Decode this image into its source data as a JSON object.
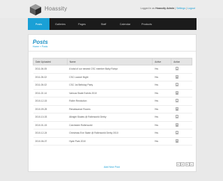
{
  "header": {
    "logo_text": "Hoassity",
    "logged_in_prefix": "Logged in as",
    "user_name": "Hoassity Admin",
    "separator1": "|",
    "settings_label": "Settings",
    "separator2": "|",
    "logout_label": "Logout"
  },
  "nav": {
    "items": [
      {
        "label": "Posts"
      },
      {
        "label": "Galleries"
      },
      {
        "label": "Pages"
      },
      {
        "label": "Staff"
      },
      {
        "label": "Calendar"
      },
      {
        "label": "Products"
      }
    ]
  },
  "main": {
    "title": "Posts",
    "breadcrumb": "Home » Posts",
    "columns": [
      "Date Uploaded",
      "Name",
      "Active",
      "Action"
    ],
    "rows": [
      {
        "date": "2011-06-05",
        "name": "A total of our newest CSC member Baby Robyn",
        "active": "Yes"
      },
      {
        "date": "2011-05-02",
        "name": "CSC Launch Night",
        "active": "Yes"
      },
      {
        "date": "2011-05-02",
        "name": "CSC 1st Birthday Party",
        "active": "Yes"
      },
      {
        "date": "2011-02-14",
        "name": "Various Skate Events 2010",
        "active": "Yes"
      },
      {
        "date": "2010-12-15",
        "name": "Roller Revolution",
        "active": "Yes"
      },
      {
        "date": "2010-09-25",
        "name": "Renaissance Rooms",
        "active": "Yes"
      },
      {
        "date": "2010-10-03",
        "name": "Allnight Skates @ Rollerworld Derby",
        "active": "Yes"
      },
      {
        "date": "2010-01-15",
        "name": "Colchester Rollerworld",
        "active": "Yes"
      },
      {
        "date": "2010-12-24",
        "name": "Christmas Eve Skate @ Rollerworld Derby 2010",
        "active": "Yes"
      },
      {
        "date": "2010-06-07",
        "name": "Hyde Park 2010",
        "active": "Yes"
      }
    ],
    "add_link": "Add New Post",
    "pagination": [
      "1",
      "2",
      "3",
      "»"
    ]
  }
}
